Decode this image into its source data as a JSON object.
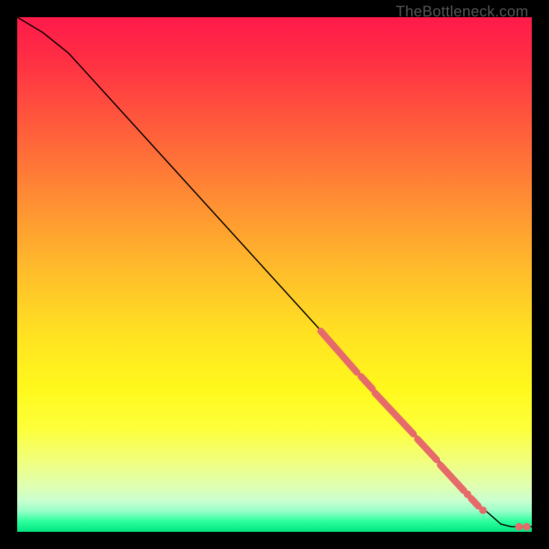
{
  "attribution": "TheBottleneck.com",
  "chart_data": {
    "type": "line",
    "title": "",
    "xlabel": "",
    "ylabel": "",
    "xlim": [
      0,
      100
    ],
    "ylim": [
      0,
      100
    ],
    "curve": [
      {
        "x": 0,
        "y": 100
      },
      {
        "x": 5,
        "y": 97
      },
      {
        "x": 10,
        "y": 93
      },
      {
        "x": 20,
        "y": 82
      },
      {
        "x": 30,
        "y": 71
      },
      {
        "x": 40,
        "y": 60
      },
      {
        "x": 50,
        "y": 49
      },
      {
        "x": 60,
        "y": 38
      },
      {
        "x": 70,
        "y": 27
      },
      {
        "x": 80,
        "y": 16
      },
      {
        "x": 90,
        "y": 5
      },
      {
        "x": 94,
        "y": 1.5
      },
      {
        "x": 96,
        "y": 1
      },
      {
        "x": 100,
        "y": 1
      }
    ],
    "highlight_segments": [
      {
        "x1": 59,
        "y1": 39,
        "x2": 66,
        "y2": 31
      },
      {
        "x1": 66.8,
        "y1": 30.2,
        "x2": 69,
        "y2": 27.8
      },
      {
        "x1": 69.5,
        "y1": 27,
        "x2": 77,
        "y2": 19
      },
      {
        "x1": 77.8,
        "y1": 18,
        "x2": 81.5,
        "y2": 14
      },
      {
        "x1": 82.2,
        "y1": 13,
        "x2": 86.8,
        "y2": 8
      },
      {
        "x1": 88.2,
        "y1": 6.5,
        "x2": 89.6,
        "y2": 5
      }
    ],
    "highlight_points": [
      {
        "x": 87.5,
        "y": 7.3
      },
      {
        "x": 90.5,
        "y": 4.2
      },
      {
        "x": 97.5,
        "y": 1.0
      },
      {
        "x": 99.0,
        "y": 1.0
      }
    ],
    "highlight_color": "#e66a6a",
    "highlight_stroke_width": 10
  }
}
